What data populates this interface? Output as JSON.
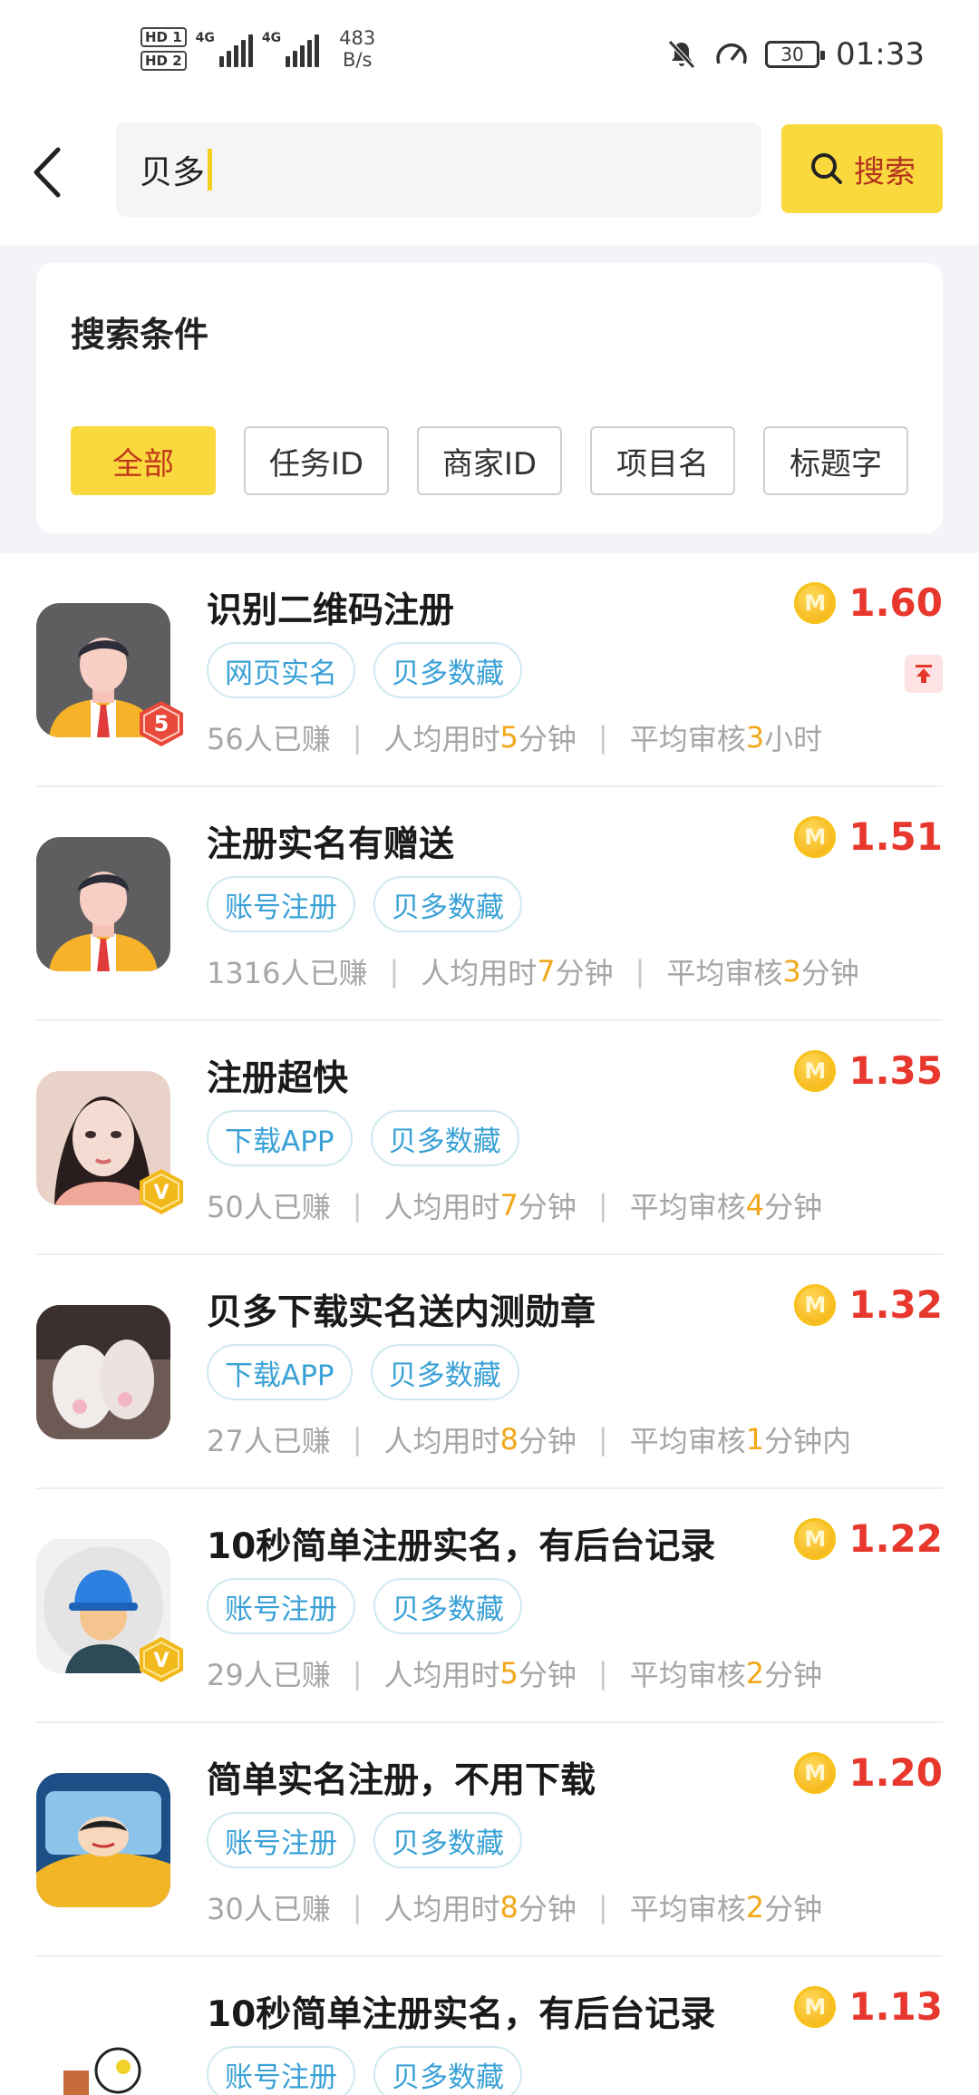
{
  "status_bar": {
    "hd1": "HD 1",
    "hd2": "HD 2",
    "net1": "4G",
    "net2": "4G",
    "speed_value": "483",
    "speed_unit": "B/s",
    "battery": "30",
    "time": "01:33"
  },
  "search": {
    "query": "贝多",
    "button_label": "搜索"
  },
  "conditions": {
    "title": "搜索条件",
    "chips": [
      "全部",
      "任务ID",
      "商家ID",
      "项目名",
      "标题字"
    ],
    "active_index": 0
  },
  "tasks": [
    {
      "title": "识别二维码注册",
      "price": "1.60",
      "tags": [
        "网页实名",
        "贝多数藏"
      ],
      "earned": "56人已赚",
      "avg_prefix": "人均用时",
      "avg_value": "5",
      "avg_unit": "分钟",
      "review_prefix": "平均审核",
      "review_value": "3",
      "review_unit": "小时",
      "avatar": "man-avatar",
      "badge": "5",
      "pinned": true
    },
    {
      "title": "注册实名有赠送",
      "price": "1.51",
      "tags": [
        "账号注册",
        "贝多数藏"
      ],
      "earned": "1316人已赚",
      "avg_prefix": "人均用时",
      "avg_value": "7",
      "avg_unit": "分钟",
      "review_prefix": "平均审核",
      "review_value": "3",
      "review_unit": "分钟",
      "avatar": "man-avatar",
      "badge": "",
      "pinned": false
    },
    {
      "title": "注册超快",
      "price": "1.35",
      "tags": [
        "下载APP",
        "贝多数藏"
      ],
      "earned": "50人已赚",
      "avg_prefix": "人均用时",
      "avg_value": "7",
      "avg_unit": "分钟",
      "review_prefix": "平均审核",
      "review_value": "4",
      "review_unit": "分钟",
      "avatar": "girl-photo",
      "badge": "V",
      "pinned": false
    },
    {
      "title": "贝多下载实名送内测勋章",
      "price": "1.32",
      "tags": [
        "下载APP",
        "贝多数藏"
      ],
      "earned": "27人已赚",
      "avg_prefix": "人均用时",
      "avg_value": "8",
      "avg_unit": "分钟",
      "review_prefix": "平均审核",
      "review_value": "1",
      "review_unit": "分钟内",
      "avatar": "feet-photo",
      "badge": "",
      "pinned": false
    },
    {
      "title": "10秒简单注册实名，有后台记录",
      "price": "1.22",
      "tags": [
        "账号注册",
        "贝多数藏"
      ],
      "earned": "29人已赚",
      "avg_prefix": "人均用时",
      "avg_value": "5",
      "avg_unit": "分钟",
      "review_prefix": "平均审核",
      "review_value": "2",
      "review_unit": "分钟",
      "avatar": "worker-avatar",
      "badge": "V",
      "pinned": false
    },
    {
      "title": "简单实名注册，不用下载",
      "price": "1.20",
      "tags": [
        "账号注册",
        "贝多数藏"
      ],
      "earned": "30人已赚",
      "avg_prefix": "人均用时",
      "avg_value": "8",
      "avg_unit": "分钟",
      "review_prefix": "平均审核",
      "review_value": "2",
      "review_unit": "分钟",
      "avatar": "cartoon-avatar",
      "badge": "",
      "pinned": false
    },
    {
      "title": "10秒简单注册实名，有后台记录",
      "price": "1.13",
      "tags": [
        "账号注册",
        "贝多数藏"
      ],
      "earned": "",
      "avg_prefix": "",
      "avg_value": "",
      "avg_unit": "",
      "review_prefix": "",
      "review_value": "",
      "review_unit": "",
      "avatar": "doodle-avatar",
      "badge": "",
      "pinned": false
    }
  ],
  "colors": {
    "accent_yellow": "#f9d93d",
    "price_red": "#e8372c",
    "tag_blue": "#3aa1d6",
    "highlight_orange": "#f1a81a"
  }
}
